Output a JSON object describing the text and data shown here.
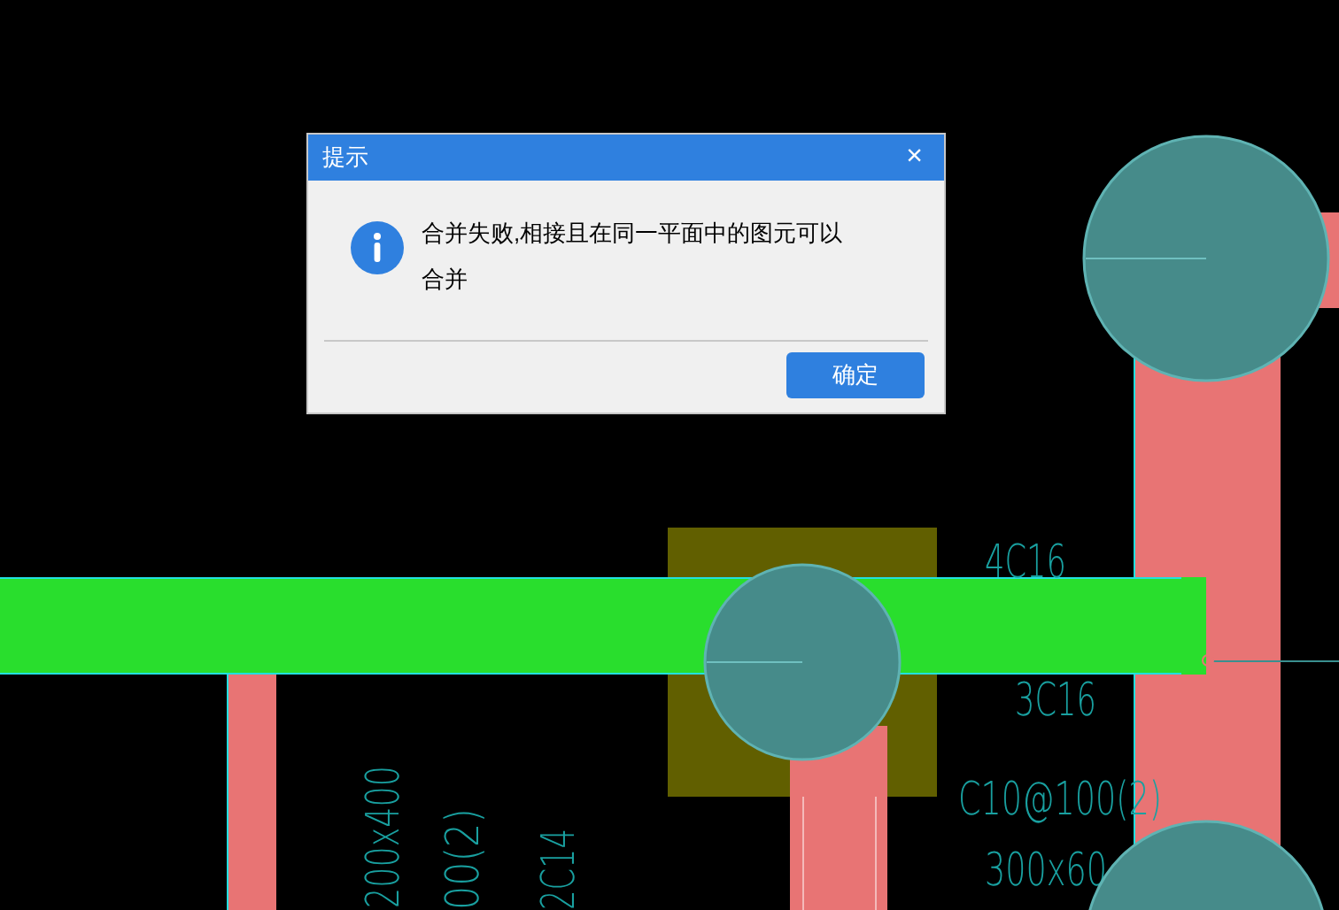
{
  "canvas": {
    "labels": [
      {
        "text": "4C16",
        "kind": "horizontal"
      },
      {
        "text": "3C16",
        "kind": "horizontal"
      },
      {
        "text": "C10@100(2)",
        "kind": "horizontal"
      },
      {
        "text": "300x60",
        "kind": "horizontal"
      },
      {
        "text": "200x400",
        "kind": "vertical"
      },
      {
        "text": "00(2)",
        "kind": "vertical"
      },
      {
        "text": "2C14",
        "kind": "vertical"
      }
    ]
  },
  "dialog": {
    "title": "提示",
    "close": "×",
    "message": "合并失败,相接且在同一平面中的图元可以合并",
    "buttons": [
      "确定"
    ]
  }
}
